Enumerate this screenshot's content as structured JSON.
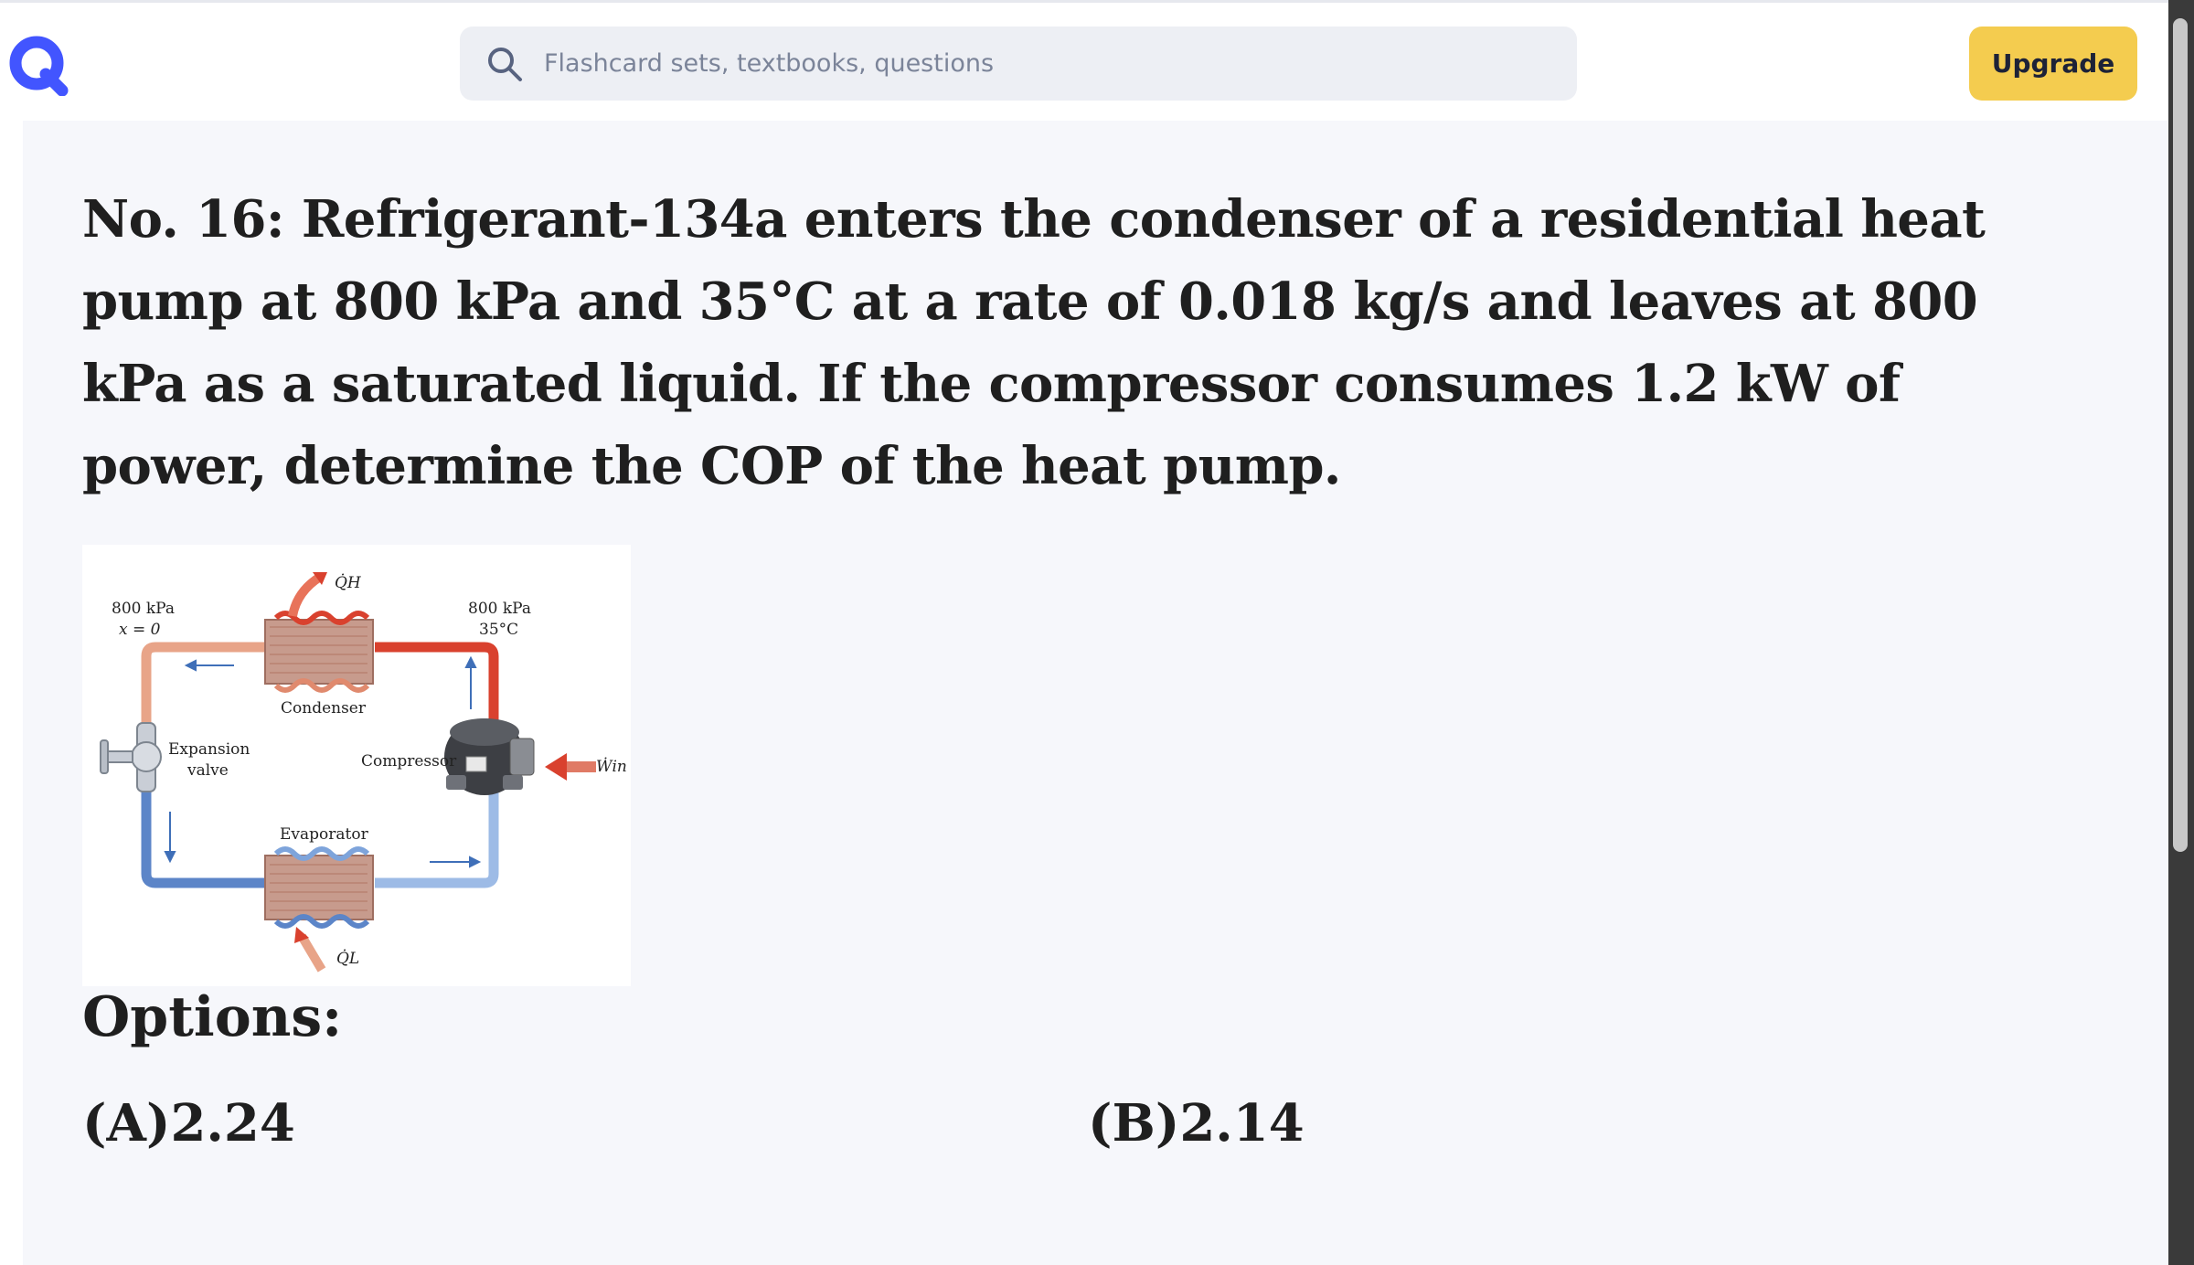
{
  "header": {
    "search_placeholder": "Flashcard sets, textbooks, questions",
    "upgrade_label": "Upgrade",
    "logo_icon": "quizlet-q-logo-icon",
    "search_icon": "search-icon"
  },
  "colors": {
    "brand": "#4255ff",
    "upgrade_bg": "#f4cc4f",
    "background": "#f6f7fb"
  },
  "question": {
    "text": "No. 16: Refrigerant-134a enters the condenser of a residential heat pump at 800 kPa and 35°C at a rate of 0.018 kg/s and leaves at 800 kPa as a saturated liquid. If the compressor consumes 1.2 kW of power, determine the COP of the heat pump."
  },
  "figure": {
    "label_left_pressure": "800 kPa",
    "label_left_quality": "x = 0",
    "label_right_pressure": "800 kPa",
    "label_right_temp": "35°C",
    "label_qh": "Q̇H",
    "label_ql": "Q̇L",
    "label_win": "Ẇin",
    "label_condenser": "Condenser",
    "label_evaporator": "Evaporator",
    "label_compressor": "Compressor",
    "label_expansion_1": "Expansion",
    "label_expansion_2": "valve"
  },
  "options": {
    "heading": "Options:",
    "items": [
      "(A)2.24",
      "(B)2.14"
    ]
  }
}
